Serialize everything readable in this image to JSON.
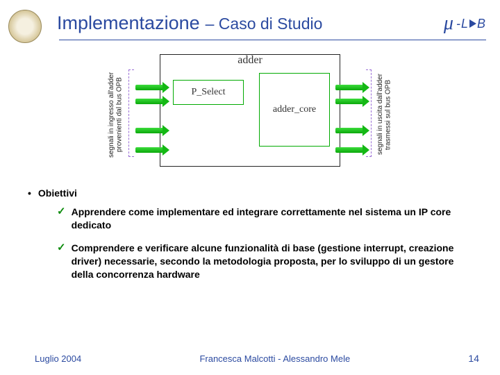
{
  "header": {
    "title_main": "Implementazione",
    "title_sub": "– Caso di Studio",
    "logo_mu": "μ",
    "logo_lab_prefix": "-L",
    "logo_lab_suffix": "B"
  },
  "diagram": {
    "left_caption": "segnali in ingresso all'adder\nprovenienti dal bus OPB",
    "right_caption": "segnali in uscita dall'adder\ntrasmessi sul bus OPB",
    "outer_label": "adder",
    "pselect_label": "P_Select",
    "core_label": "adder_core"
  },
  "content": {
    "heading": "Obiettivi",
    "items": [
      "Apprendere come implementare ed integrare correttamente nel sistema un IP core dedicato",
      "Comprendere e verificare alcune funzionalità di base (gestione interrupt, creazione driver) necessarie, secondo la metodologia proposta, per lo sviluppo di un gestore della concorrenza hardware"
    ]
  },
  "footer": {
    "date": "Luglio 2004",
    "authors": "Francesca Malcotti - Alessandro Mele",
    "page": "14"
  }
}
